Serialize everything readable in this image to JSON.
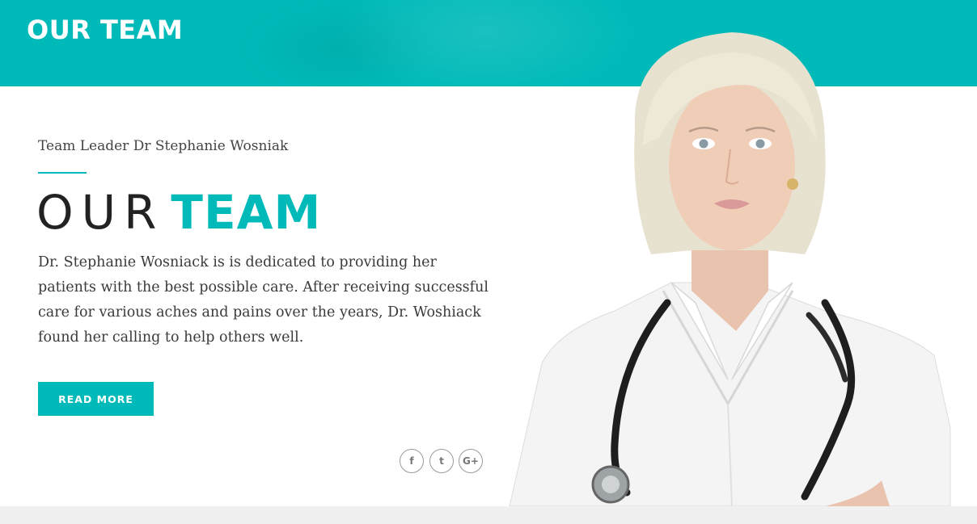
{
  "banner": {
    "title": "OUR TEAM"
  },
  "profile": {
    "subtitle": "Team Leader Dr Stephanie Wosniak",
    "heading_light": "OUR",
    "heading_bold": "TEAM",
    "description": "Dr. Stephanie Wosniack is is dedicated to providing her patients with the best possible care. After receiving successful care for various aches and pains over the years, Dr. Woshiack found her calling to help others well.",
    "read_more_label": "READ MORE"
  },
  "social": [
    {
      "icon": "facebook-icon",
      "glyph": "f"
    },
    {
      "icon": "twitter-icon",
      "glyph": "t"
    },
    {
      "icon": "google-plus-icon",
      "glyph": "G+"
    }
  ],
  "colors": {
    "accent": "#00bab9",
    "text": "#3a3a3a",
    "heading": "#222222",
    "footer": "#f0f0f0"
  }
}
